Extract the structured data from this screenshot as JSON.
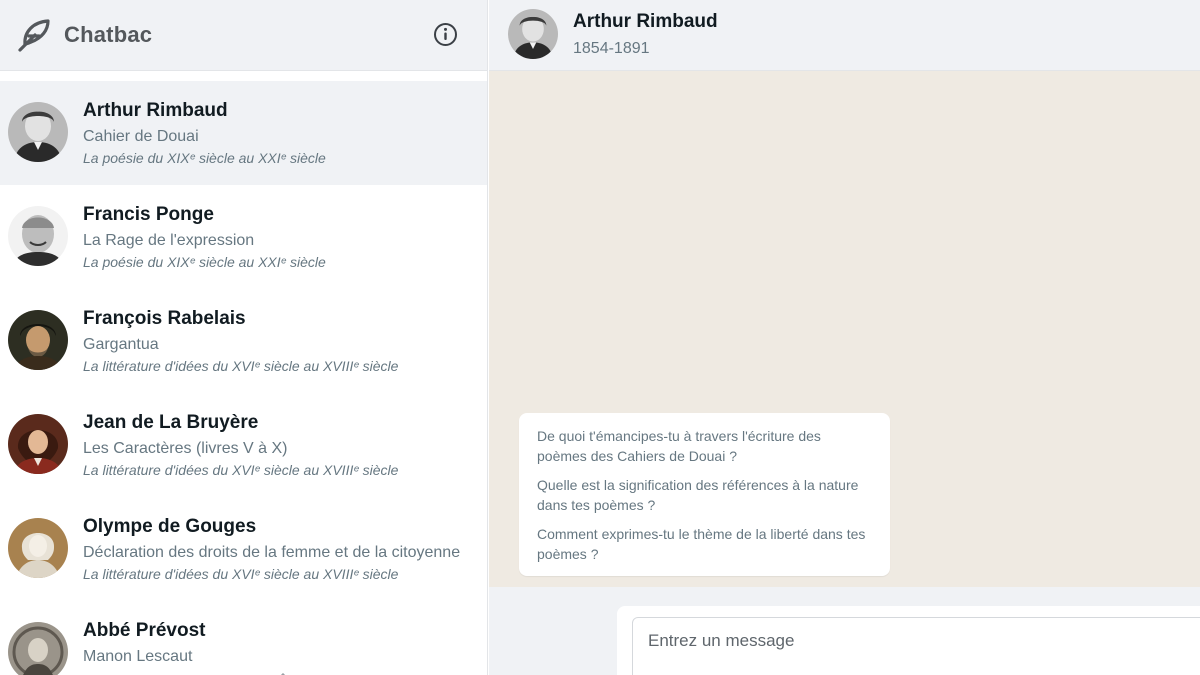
{
  "app": {
    "title": "Chatbac"
  },
  "contacts": [
    {
      "name": "Arthur Rimbaud",
      "work": "Cahier de Douai",
      "period": "La poésie du XIXᵉ siècle au XXIᵉ siècle",
      "active": true
    },
    {
      "name": "Francis Ponge",
      "work": "La Rage de l'expression",
      "period": "La poésie du XIXᵉ siècle au XXIᵉ siècle",
      "active": false
    },
    {
      "name": "François Rabelais",
      "work": "Gargantua",
      "period": "La littérature d'idées du XVIᵉ siècle au XVIIIᵉ siècle",
      "active": false
    },
    {
      "name": "Jean de La Bruyère",
      "work": "Les Caractères (livres V à X)",
      "period": "La littérature d'idées du XVIᵉ siècle au XVIIIᵉ siècle",
      "active": false
    },
    {
      "name": "Olympe de Gouges",
      "work": "Déclaration des droits de la femme et de la citoyenne",
      "period": "La littérature d'idées du XVIᵉ siècle au XVIIIᵉ siècle",
      "active": false
    },
    {
      "name": "Abbé Prévost",
      "work": "Manon Lescaut",
      "period": "",
      "active": false
    }
  ],
  "chat": {
    "name": "Arthur Rimbaud",
    "dates": "1854-1891",
    "suggestions": [
      "De quoi t'émancipes-tu à travers l'écriture des poèmes des Cahiers de Douai ?",
      "Quelle est la signification des références à la nature dans tes poèmes ?",
      "Comment exprimes-tu le thème de la liberté dans tes poèmes ?"
    ],
    "input_placeholder": "Entrez un message"
  },
  "icons": {
    "logo": "quill-feather-icon",
    "info": "info-circle-icon",
    "scroll": "chevron-up-icon"
  },
  "colors": {
    "header_bg": "#f0f2f5",
    "chat_bg": "#efeae2",
    "active_row": "#f0f2f5",
    "secondary_text": "#667781"
  }
}
